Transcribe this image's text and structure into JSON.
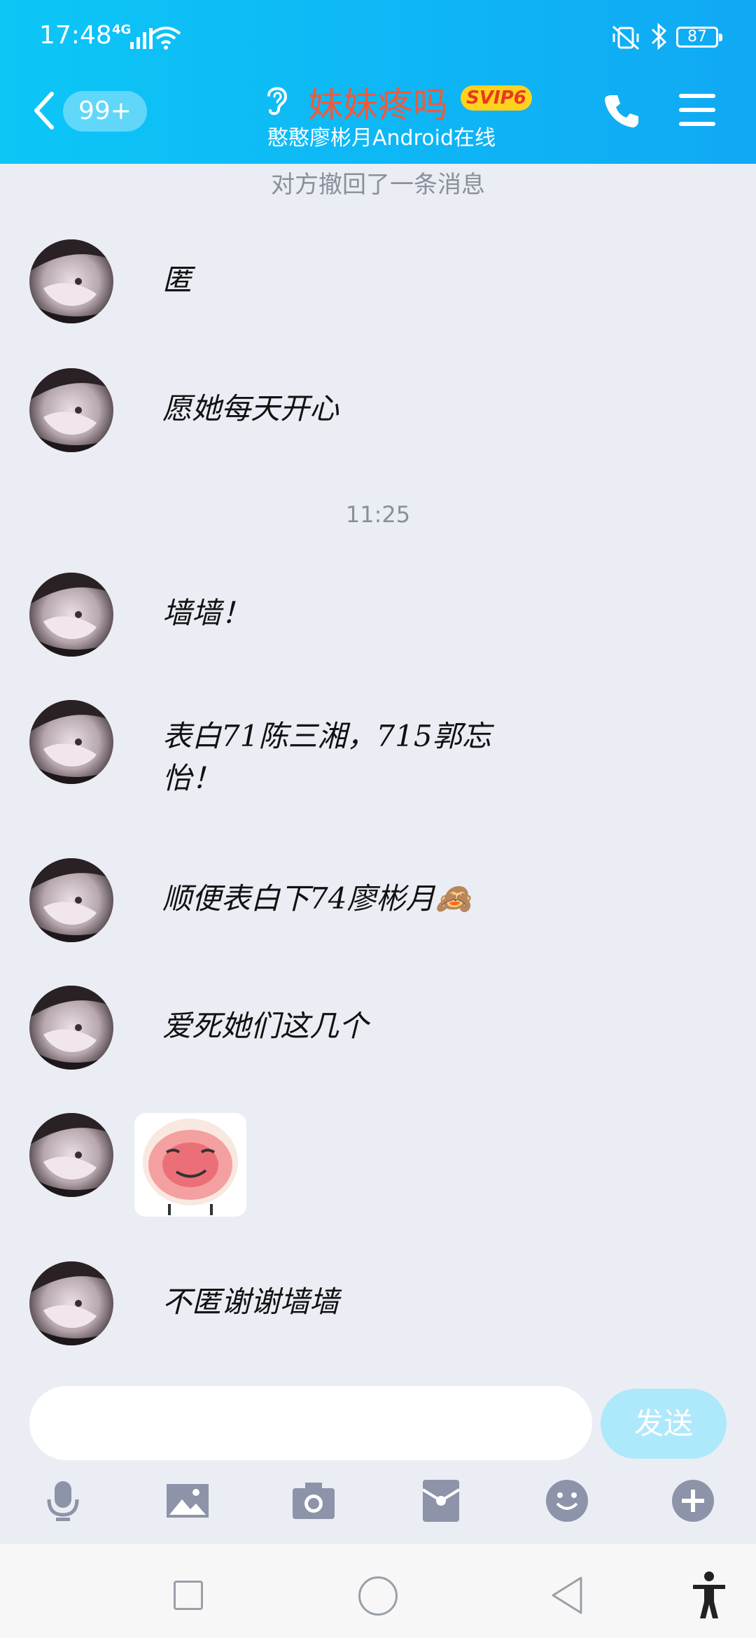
{
  "status_bar": {
    "time": "17:48",
    "network": "4G",
    "battery": "87"
  },
  "header": {
    "unread_count": "99+",
    "contact_name": "妹妹疼吗",
    "vip_badge": "SVIP6",
    "status": "憨憨廖彬月Android在线"
  },
  "chat": {
    "recall_notice": "对方撤回了一条消息",
    "time_divider": "11:25",
    "messages": [
      {
        "text": "匿"
      },
      {
        "text": "愿她每天开心"
      },
      {
        "text": "墙墙！"
      },
      {
        "text_line1": "表白71陈三湘，715郭忘",
        "text_line2": "怡！"
      },
      {
        "text": "顺便表白下74廖彬月🙈"
      },
      {
        "text": "爱死她们这几个"
      },
      {
        "type": "sticker"
      },
      {
        "text": "不匿谢谢墙墙"
      }
    ]
  },
  "composer": {
    "input_value": "",
    "send_label": "发送"
  },
  "toolbar": [
    "microphone-icon",
    "image-icon",
    "camera-icon",
    "red-packet-icon",
    "emoji-icon",
    "plus-icon"
  ],
  "colors": {
    "header_start": "#0cc6f6",
    "header_end": "#10a9f4",
    "chat_bg": "#ebedf4",
    "send_disabled": "#aee8fb",
    "name_color": "#f05a3a"
  }
}
